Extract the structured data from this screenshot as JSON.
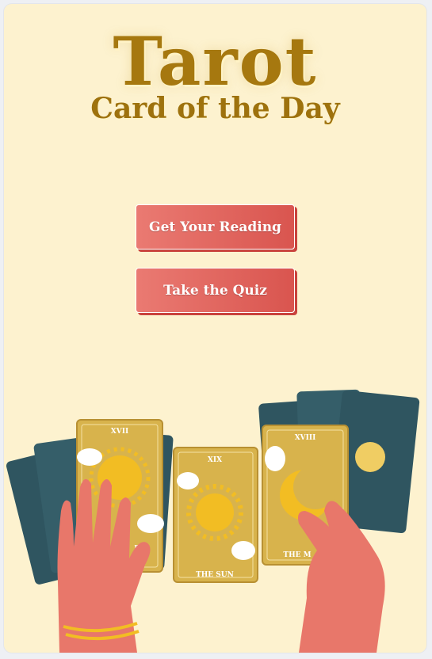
{
  "title": {
    "main": "Tarot",
    "sub": "Card of the Day"
  },
  "buttons": {
    "reading": "Get Your Reading",
    "quiz": "Take the Quiz"
  },
  "cards": {
    "left_numeral": "XVII",
    "left_name": "R",
    "center_numeral": "XIX",
    "center_name": "THE SUN",
    "right_numeral": "XVIII",
    "right_name": "THE M"
  },
  "colors": {
    "background": "#fdf2cf",
    "title_gold": "#a6780f",
    "button_red": "#e06760",
    "card_gold": "#d8b34c",
    "card_teal": "#2f5560",
    "hand_skin": "#e8776a"
  }
}
